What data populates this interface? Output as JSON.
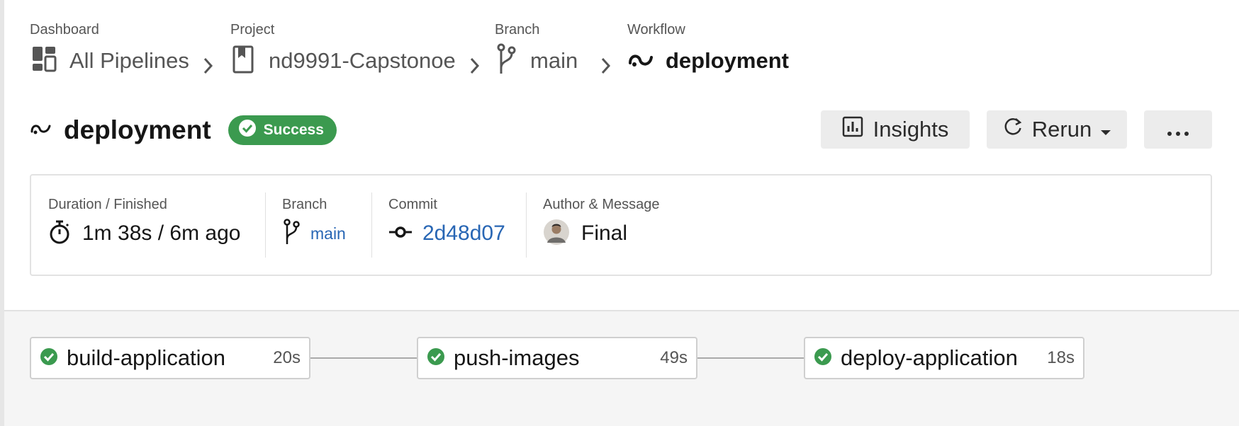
{
  "breadcrumb": {
    "dashboard": {
      "label": "Dashboard",
      "value": "All Pipelines",
      "icon": "dashboard-icon"
    },
    "project": {
      "label": "Project",
      "value": "nd9991-Capstonoe",
      "icon": "bookmark-icon"
    },
    "branch": {
      "label": "Branch",
      "value": "main",
      "icon": "branch-icon"
    },
    "workflow": {
      "label": "Workflow",
      "value": "deployment",
      "icon": "workflow-icon"
    }
  },
  "header": {
    "title": "deployment",
    "status": "Success",
    "status_color": "#3b9a4f",
    "insights_label": "Insights",
    "rerun_label": "Rerun",
    "more_icon": "more-horizontal-icon"
  },
  "summary": {
    "duration": {
      "label": "Duration / Finished",
      "value": "1m 38s / 6m ago"
    },
    "branch": {
      "label": "Branch",
      "value": "main"
    },
    "commit": {
      "label": "Commit",
      "value": "2d48d07"
    },
    "author": {
      "label": "Author & Message",
      "value": "Final"
    },
    "link_color": "#2866b4"
  },
  "jobs": [
    {
      "name": "build-application",
      "duration": "20s",
      "status": "success"
    },
    {
      "name": "push-images",
      "duration": "49s",
      "status": "success"
    },
    {
      "name": "deploy-application",
      "duration": "18s",
      "status": "success"
    }
  ]
}
